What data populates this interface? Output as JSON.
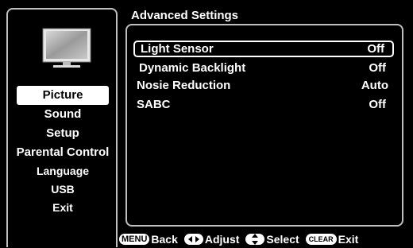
{
  "sidebar": {
    "tv_icon": "tv-icon",
    "items": [
      {
        "label": "Picture",
        "selected": true
      },
      {
        "label": "Sound"
      },
      {
        "label": "Setup"
      },
      {
        "label": "Parental Control"
      },
      {
        "label": "Language"
      },
      {
        "label": "USB"
      },
      {
        "label": "Exit"
      }
    ]
  },
  "main": {
    "title": "Advanced Settings",
    "rows": [
      {
        "label": "Light Sensor",
        "value": "Off",
        "selected": true
      },
      {
        "label": "Dynamic Backlight",
        "value": "Off"
      },
      {
        "label": "Nosie Reduction",
        "value": "Auto"
      },
      {
        "label": "SABC",
        "value": "Off"
      }
    ]
  },
  "footer": {
    "menu_key": "MENU",
    "menu_label": "Back",
    "adjust_key_icon": "left-right-arrows-icon",
    "adjust_label": "Adjust",
    "select_key_icon": "up-down-arrows-icon",
    "select_label": "Select",
    "clear_key": "CLEAR",
    "clear_label": "Exit"
  },
  "colors": {
    "background": "#000000",
    "border": "#bfbfbf",
    "text": "#ffffff",
    "highlight": "#ffffff"
  }
}
